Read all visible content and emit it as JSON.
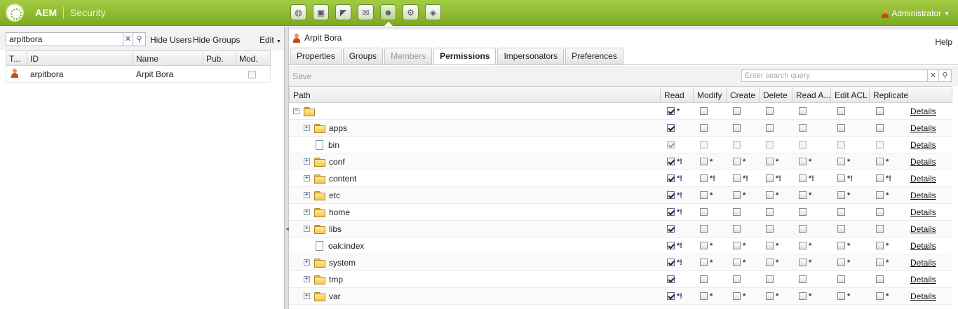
{
  "header": {
    "brand": "AEM",
    "section": "Security",
    "user_label": "Administrator"
  },
  "nav_icons": [
    "globe-icon",
    "camera-icon",
    "megaphone-icon",
    "mail-icon",
    "users-icon",
    "gear-icon",
    "tag-icon"
  ],
  "left": {
    "search_value": "arpitbora",
    "hide_users": "Hide Users",
    "hide_groups": "Hide Groups",
    "edit": "Edit",
    "columns": [
      "T...",
      "ID",
      "Name",
      "Pub.",
      "Mod."
    ],
    "rows": [
      {
        "id": "arpitbora",
        "name": "Arpit Bora"
      }
    ]
  },
  "right": {
    "title": "Arpit Bora",
    "help": "Help",
    "tabs": [
      "Properties",
      "Groups",
      "Members",
      "Permissions",
      "Impersonators",
      "Preferences"
    ],
    "save": "Save",
    "search_placeholder": "Enter search query",
    "columns": [
      "Path",
      "Read",
      "Modify",
      "Create",
      "Delete",
      "Read A...",
      "Edit ACL",
      "Replicate"
    ],
    "details_label": "Details",
    "rows": [
      {
        "name": "",
        "type": "folder",
        "toggle": "−",
        "perms": [
          [
            true,
            "*"
          ],
          [
            false,
            ""
          ],
          [
            false,
            ""
          ],
          [
            false,
            ""
          ],
          [
            false,
            ""
          ],
          [
            false,
            ""
          ],
          [
            false,
            ""
          ]
        ]
      },
      {
        "name": "apps",
        "type": "folder",
        "toggle": "+",
        "perms": [
          [
            true,
            ""
          ],
          [
            false,
            ""
          ],
          [
            false,
            ""
          ],
          [
            false,
            ""
          ],
          [
            false,
            ""
          ],
          [
            false,
            ""
          ],
          [
            false,
            ""
          ]
        ]
      },
      {
        "name": "bin",
        "type": "file",
        "toggle": "",
        "perms": [
          [
            true,
            ""
          ],
          [
            false,
            ""
          ],
          [
            false,
            ""
          ],
          [
            false,
            ""
          ],
          [
            false,
            ""
          ],
          [
            false,
            ""
          ],
          [
            false,
            ""
          ]
        ]
      },
      {
        "name": "conf",
        "type": "folder",
        "toggle": "+",
        "perms": [
          [
            true,
            "*!"
          ],
          [
            false,
            "*"
          ],
          [
            false,
            "*"
          ],
          [
            false,
            "*"
          ],
          [
            false,
            "*"
          ],
          [
            false,
            "*"
          ],
          [
            false,
            "*"
          ]
        ]
      },
      {
        "name": "content",
        "type": "folder",
        "toggle": "+",
        "perms": [
          [
            true,
            "*!"
          ],
          [
            false,
            "*!"
          ],
          [
            false,
            "*!"
          ],
          [
            false,
            "*!"
          ],
          [
            false,
            "*!"
          ],
          [
            false,
            "*!"
          ],
          [
            false,
            "*!"
          ]
        ]
      },
      {
        "name": "etc",
        "type": "folder",
        "toggle": "+",
        "perms": [
          [
            true,
            "*!"
          ],
          [
            false,
            "*"
          ],
          [
            false,
            "*"
          ],
          [
            false,
            "*"
          ],
          [
            false,
            "*"
          ],
          [
            false,
            "*"
          ],
          [
            false,
            "*"
          ]
        ]
      },
      {
        "name": "home",
        "type": "folder",
        "toggle": "+",
        "perms": [
          [
            true,
            "*!"
          ],
          [
            false,
            ""
          ],
          [
            false,
            ""
          ],
          [
            false,
            ""
          ],
          [
            false,
            ""
          ],
          [
            false,
            ""
          ],
          [
            false,
            ""
          ]
        ]
      },
      {
        "name": "libs",
        "type": "folder",
        "toggle": "+",
        "perms": [
          [
            true,
            ""
          ],
          [
            false,
            ""
          ],
          [
            false,
            ""
          ],
          [
            false,
            ""
          ],
          [
            false,
            ""
          ],
          [
            false,
            ""
          ],
          [
            false,
            ""
          ]
        ]
      },
      {
        "name": "oak:index",
        "type": "file",
        "toggle": "",
        "perms": [
          [
            true,
            "*!"
          ],
          [
            false,
            "*"
          ],
          [
            false,
            "*"
          ],
          [
            false,
            "*"
          ],
          [
            false,
            "*"
          ],
          [
            false,
            "*"
          ],
          [
            false,
            "*"
          ]
        ]
      },
      {
        "name": "system",
        "type": "folder",
        "toggle": "+",
        "perms": [
          [
            true,
            "*!"
          ],
          [
            false,
            "*"
          ],
          [
            false,
            "*"
          ],
          [
            false,
            "*"
          ],
          [
            false,
            "*"
          ],
          [
            false,
            "*"
          ],
          [
            false,
            "*"
          ]
        ]
      },
      {
        "name": "tmp",
        "type": "folder",
        "toggle": "+",
        "perms": [
          [
            true,
            ""
          ],
          [
            false,
            ""
          ],
          [
            false,
            ""
          ],
          [
            false,
            ""
          ],
          [
            false,
            ""
          ],
          [
            false,
            ""
          ],
          [
            false,
            ""
          ]
        ]
      },
      {
        "name": "var",
        "type": "folder",
        "toggle": "+",
        "perms": [
          [
            true,
            "*!"
          ],
          [
            false,
            "*"
          ],
          [
            false,
            "*"
          ],
          [
            false,
            "*"
          ],
          [
            false,
            "*"
          ],
          [
            false,
            "*"
          ],
          [
            false,
            "*"
          ]
        ]
      }
    ]
  }
}
